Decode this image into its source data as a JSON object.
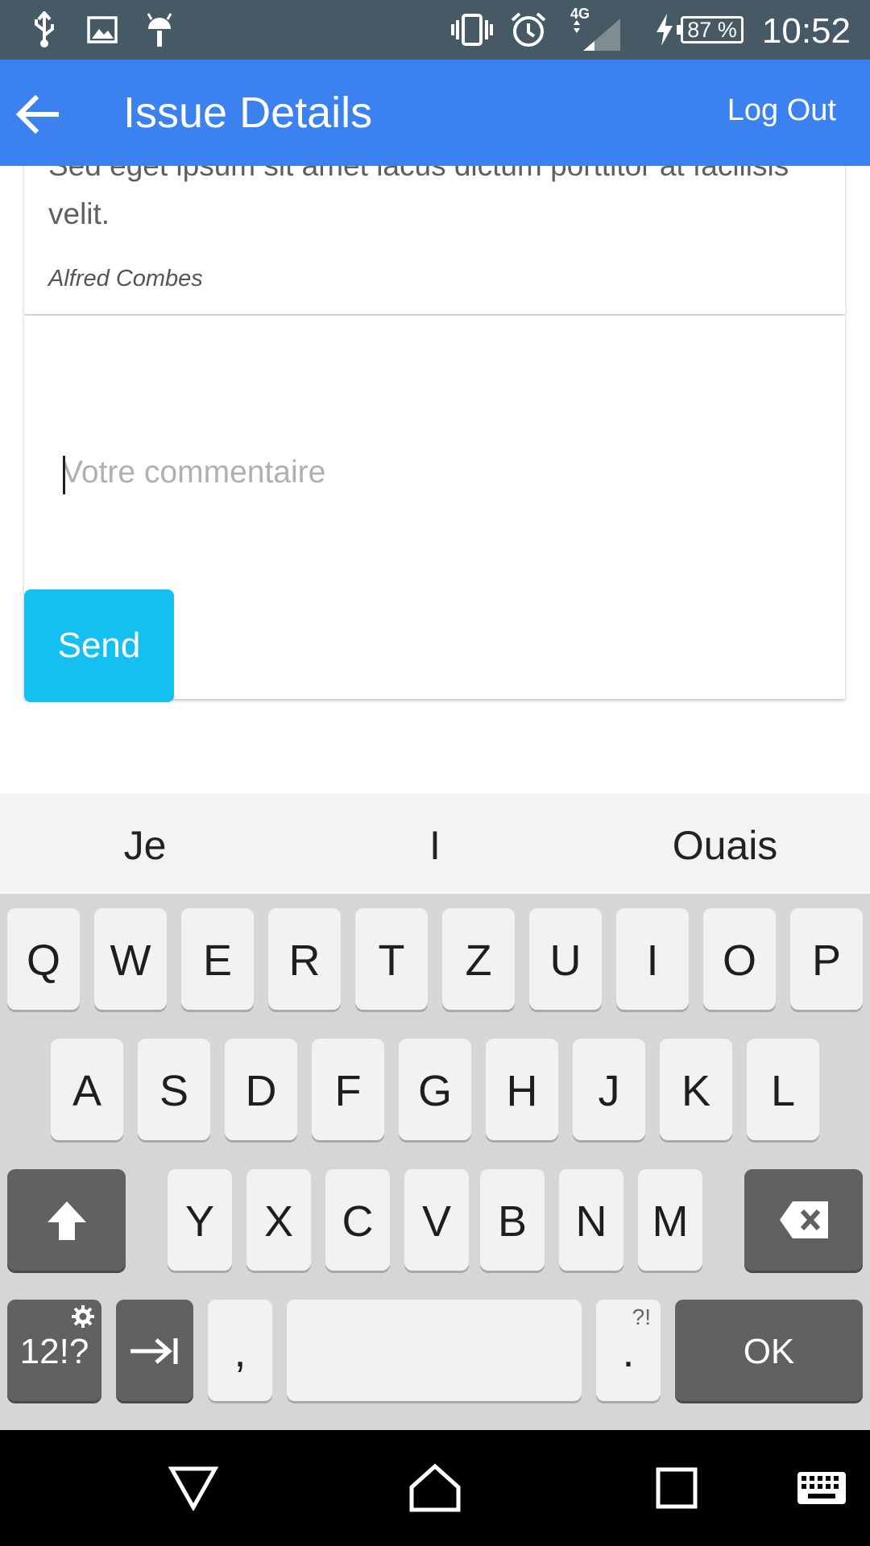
{
  "status_bar": {
    "battery": "87 %",
    "network": "4G",
    "time": "10:52",
    "icons": [
      "usb-icon",
      "image-icon",
      "android-icon",
      "vibrate-icon",
      "alarm-icon",
      "signal-icon",
      "charging-icon"
    ]
  },
  "app_bar": {
    "title": "Issue Details",
    "logout_label": "Log Out"
  },
  "comment": {
    "text": "Sed eget ipsum sit amet lacus dictum porttitor at facilisis velit.",
    "author": "Alfred Combes"
  },
  "form": {
    "placeholder": "Votre commentaire",
    "send_label": "Send"
  },
  "keyboard": {
    "suggestions": [
      "Je",
      "I",
      "Ouais"
    ],
    "row1": [
      "Q",
      "W",
      "E",
      "R",
      "T",
      "Z",
      "U",
      "I",
      "O",
      "P"
    ],
    "row2": [
      "A",
      "S",
      "D",
      "F",
      "G",
      "H",
      "J",
      "K",
      "L"
    ],
    "row3": [
      "Y",
      "X",
      "C",
      "V",
      "B",
      "N",
      "M"
    ],
    "symbols_label": "12!?",
    "comma_label": ",",
    "period_label": ".",
    "period_sub": "?!",
    "ok_label": "OK"
  },
  "colors": {
    "status_bar": "#455a64",
    "app_bar": "#3b82f0",
    "send_button": "#14c0f0",
    "keyboard_bg": "#d6d6d6"
  }
}
